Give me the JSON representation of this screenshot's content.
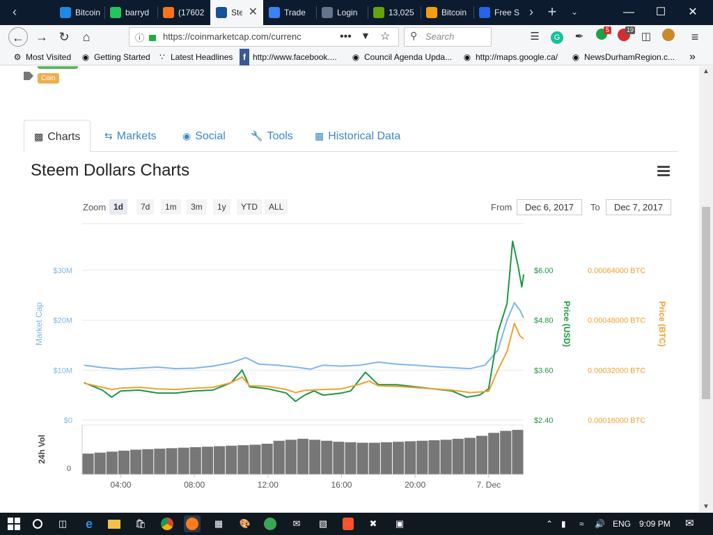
{
  "browser": {
    "tabs": [
      {
        "label": "Bitcoin",
        "color": "#1e88e5"
      },
      {
        "label": "barryd",
        "color": "#22c55e"
      },
      {
        "label": "(17602",
        "color": "#f97316"
      },
      {
        "label": "Steem",
        "color": "#1a5099",
        "active": true
      },
      {
        "label": "Trade",
        "color": "#3b82f6"
      },
      {
        "label": "Login",
        "color": "#64748b"
      },
      {
        "label": "13,025",
        "color": "#65a30d"
      },
      {
        "label": "Bitcoin",
        "color": "#f59e0b"
      },
      {
        "label": "Free S",
        "color": "#2563eb"
      }
    ],
    "url": "https://coinmarketcap.com/currenc",
    "search_placeholder": "Search",
    "badge_counts": {
      "extension_a": "5",
      "extension_b": "19"
    },
    "bookmarks": [
      "Most Visited",
      "Getting Started",
      "Latest Headlines",
      "http://www.facebook....",
      "Council Agenda Upda...",
      "http://maps.google.ca/",
      "NewsDurhamRegion.c..."
    ]
  },
  "page": {
    "tag_label": "Coin",
    "tabs": [
      {
        "label": "Charts",
        "icon": "bar-chart-icon"
      },
      {
        "label": "Markets",
        "icon": "exchange-icon"
      },
      {
        "label": "Social",
        "icon": "globe-icon"
      },
      {
        "label": "Tools",
        "icon": "wrench-icon"
      },
      {
        "label": "Historical Data",
        "icon": "calendar-icon"
      }
    ],
    "chart_title": "Steem Dollars Charts",
    "zoom_label": "Zoom",
    "zoom_options": [
      "1d",
      "7d",
      "1m",
      "3m",
      "1y",
      "YTD",
      "ALL"
    ],
    "zoom_selected": "1d",
    "from_label": "From",
    "from_date": "Dec 6, 2017",
    "to_label": "To",
    "to_date": "Dec 7, 2017"
  },
  "chart_data": {
    "type": "line",
    "x_ticks": [
      "04:00",
      "08:00",
      "12:00",
      "16:00",
      "20:00",
      "7. Dec"
    ],
    "x_hours_range": [
      1.9,
      25.9
    ],
    "y_left": {
      "label": "Market Cap",
      "ticks": [
        "$0",
        "$10M",
        "$20M",
        "$30M"
      ],
      "range": [
        0,
        30
      ]
    },
    "y_right_usd": {
      "label": "Price (USD)",
      "ticks": [
        "$2.40",
        "$3.60",
        "$4.80",
        "$6.00"
      ],
      "range": [
        2.4,
        6.0
      ]
    },
    "y_right_btc": {
      "label": "Price (BTC)",
      "ticks": [
        "0.00016000 BTC",
        "0.00032000 BTC",
        "0.00048000 BTC",
        "0.00064000 BTC"
      ],
      "range": [
        0.00016,
        0.00064
      ]
    },
    "volume": {
      "label": "24h Vol",
      "zero_label": "0"
    },
    "colors": {
      "market_cap": "#7cb5ec",
      "usd": "#1a9641",
      "btc": "#f0a030",
      "volume": "#777777"
    },
    "series": [
      {
        "name": "Market Cap",
        "axis": "left",
        "points": [
          [
            2,
            11
          ],
          [
            3,
            10.5
          ],
          [
            4,
            10.2
          ],
          [
            5,
            10.4
          ],
          [
            6,
            10.6
          ],
          [
            7,
            10.3
          ],
          [
            8,
            10.4
          ],
          [
            9,
            10.8
          ],
          [
            10,
            11.5
          ],
          [
            10.8,
            12.5
          ],
          [
            11.5,
            11.2
          ],
          [
            12.5,
            11
          ],
          [
            13.5,
            10.6
          ],
          [
            14.3,
            10.2
          ],
          [
            15,
            11
          ],
          [
            16,
            10.8
          ],
          [
            17,
            11
          ],
          [
            18,
            11.6
          ],
          [
            19,
            11.2
          ],
          [
            20,
            11
          ],
          [
            21,
            10.7
          ],
          [
            22,
            10.5
          ],
          [
            23,
            10.3
          ],
          [
            23.8,
            11
          ],
          [
            24.5,
            14
          ],
          [
            25,
            20
          ],
          [
            25.4,
            23.5
          ],
          [
            25.7,
            22
          ],
          [
            25.9,
            20.5
          ]
        ]
      },
      {
        "name": "Price (USD)",
        "axis": "usd",
        "points": [
          [
            2,
            3.3
          ],
          [
            3,
            3.12
          ],
          [
            3.5,
            2.95
          ],
          [
            4,
            3.1
          ],
          [
            5,
            3.12
          ],
          [
            6,
            3.05
          ],
          [
            7,
            3.05
          ],
          [
            8,
            3.1
          ],
          [
            9,
            3.12
          ],
          [
            10,
            3.3
          ],
          [
            10.6,
            3.6
          ],
          [
            11,
            3.2
          ],
          [
            12,
            3.15
          ],
          [
            13,
            3.05
          ],
          [
            13.5,
            2.85
          ],
          [
            14,
            3.0
          ],
          [
            14.5,
            3.1
          ],
          [
            15,
            3.0
          ],
          [
            16,
            3.05
          ],
          [
            16.5,
            3.1
          ],
          [
            17.3,
            3.55
          ],
          [
            18,
            3.25
          ],
          [
            19,
            3.25
          ],
          [
            20,
            3.2
          ],
          [
            21,
            3.15
          ],
          [
            22,
            3.1
          ],
          [
            22.8,
            2.95
          ],
          [
            23.5,
            3.0
          ],
          [
            24,
            3.15
          ],
          [
            24.5,
            4.5
          ],
          [
            25,
            5.2
          ],
          [
            25.3,
            6.7
          ],
          [
            25.6,
            6.1
          ],
          [
            25.8,
            5.6
          ],
          [
            25.9,
            5.9
          ]
        ]
      },
      {
        "name": "Price (BTC)",
        "axis": "btc",
        "points": [
          [
            2,
            0.000278
          ],
          [
            3,
            0.000265
          ],
          [
            3.5,
            0.000258
          ],
          [
            4,
            0.000262
          ],
          [
            5,
            0.000265
          ],
          [
            6,
            0.00026
          ],
          [
            7,
            0.000258
          ],
          [
            8,
            0.000262
          ],
          [
            9,
            0.000265
          ],
          [
            10,
            0.00028
          ],
          [
            10.6,
            0.000298
          ],
          [
            11,
            0.00027
          ],
          [
            12,
            0.000268
          ],
          [
            13,
            0.000258
          ],
          [
            13.5,
            0.000248
          ],
          [
            14,
            0.000255
          ],
          [
            15,
            0.000258
          ],
          [
            16,
            0.00026
          ],
          [
            17,
            0.000275
          ],
          [
            17.5,
            0.000285
          ],
          [
            18,
            0.00027
          ],
          [
            19,
            0.000268
          ],
          [
            20,
            0.000264
          ],
          [
            21,
            0.00026
          ],
          [
            22,
            0.000256
          ],
          [
            23,
            0.000248
          ],
          [
            24,
            0.000252
          ],
          [
            24.5,
            0.00032
          ],
          [
            25,
            0.00038
          ],
          [
            25.4,
            0.00047
          ],
          [
            25.7,
            0.00043
          ],
          [
            25.9,
            0.00042
          ]
        ]
      },
      {
        "name": "24h Vol",
        "axis": "volume",
        "levels": [
          0.42,
          0.44,
          0.46,
          0.48,
          0.5,
          0.51,
          0.52,
          0.53,
          0.54,
          0.55,
          0.56,
          0.57,
          0.58,
          0.59,
          0.6,
          0.62,
          0.68,
          0.7,
          0.72,
          0.7,
          0.68,
          0.66,
          0.65,
          0.64,
          0.64,
          0.65,
          0.66,
          0.67,
          0.68,
          0.69,
          0.7,
          0.72,
          0.74,
          0.78,
          0.84,
          0.88,
          0.9
        ]
      }
    ]
  },
  "taskbar": {
    "language": "ENG",
    "time": "9:09 PM"
  }
}
